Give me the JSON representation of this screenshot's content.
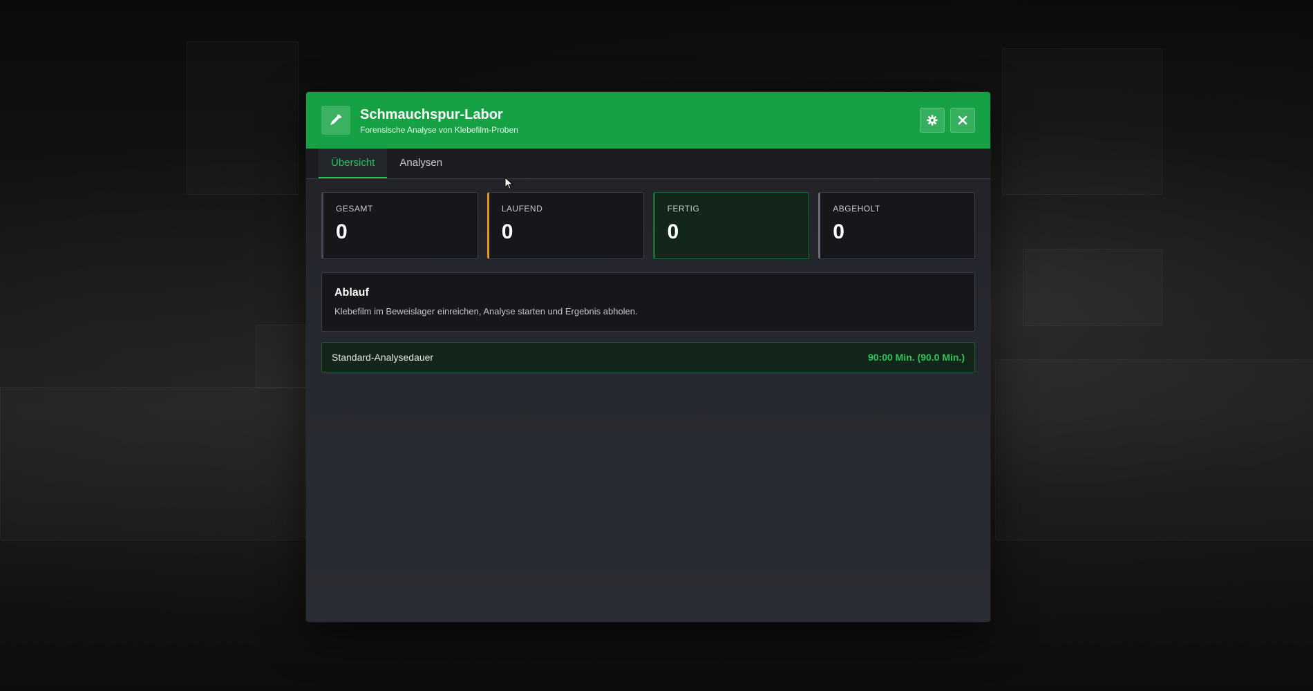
{
  "window": {
    "title": "Schmauchspur-Labor",
    "subtitle": "Forensische Analyse von Klebefilm-Proben",
    "app_icon": "pipette-icon",
    "settings_icon": "gear-icon",
    "close_icon": "close-icon"
  },
  "tabs": [
    {
      "label": "Übersicht",
      "active": true
    },
    {
      "label": "Analysen",
      "active": false
    }
  ],
  "stats": [
    {
      "label": "GESAMT",
      "value": "0",
      "color": "#474a52"
    },
    {
      "label": "LAUFEND",
      "value": "0",
      "color": "#e39a16"
    },
    {
      "label": "FERTIG",
      "value": "0",
      "color": "#1f9a48"
    },
    {
      "label": "ABGEHOLT",
      "value": "0",
      "color": "#6b6e78"
    }
  ],
  "workflow": {
    "title": "Ablauf",
    "text": "Klebefilm im Beweislager einreichen, Analyse starten und Ergebnis abholen."
  },
  "duration": {
    "label": "Standard-Analysedauer",
    "value": "90:00 Min. (90.0 Min.)"
  },
  "colors": {
    "accent": "#16a244",
    "accent_text": "#22c55e",
    "background": "#26282f"
  }
}
